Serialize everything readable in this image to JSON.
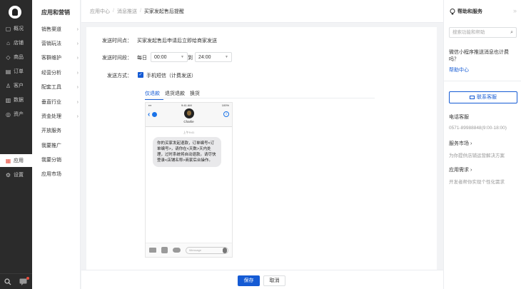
{
  "nav1": {
    "items": [
      {
        "icon": "overview-icon",
        "glyph": "▢",
        "label": "概况"
      },
      {
        "icon": "store-icon",
        "glyph": "⌂",
        "label": "店铺"
      },
      {
        "icon": "goods-icon",
        "glyph": "◇",
        "label": "商品"
      },
      {
        "icon": "order-icon",
        "glyph": "▤",
        "label": "订单"
      },
      {
        "icon": "customer-icon",
        "glyph": "♙",
        "label": "客户"
      },
      {
        "icon": "data-icon",
        "glyph": "▥",
        "label": "数据"
      },
      {
        "icon": "asset-icon",
        "glyph": "◎",
        "label": "资产"
      },
      {
        "icon": "app-icon",
        "glyph": "▦",
        "label": "应用"
      },
      {
        "icon": "settings-icon",
        "glyph": "⚙",
        "label": "设置"
      }
    ]
  },
  "nav2": {
    "title": "应用和营销",
    "items": [
      {
        "label": "销售渠道",
        "chevron": "›"
      },
      {
        "label": "营销玩法",
        "chevron": "›"
      },
      {
        "label": "客群维护",
        "chevron": "›"
      },
      {
        "label": "经营分析",
        "chevron": "›"
      },
      {
        "label": "配套工具",
        "chevron": "›"
      },
      {
        "label": "垂直行业",
        "chevron": "›"
      },
      {
        "label": "资金处理",
        "chevron": "›"
      },
      {
        "label": "开放服务",
        "chevron": ""
      },
      {
        "label": "我要推广",
        "chevron": ""
      },
      {
        "label": "我要分销",
        "chevron": ""
      },
      {
        "label": "应用市场",
        "chevron": ""
      }
    ]
  },
  "breadcrumb": {
    "a": "应用中心",
    "b": "消息推送",
    "c": "买家发起售后提醒",
    "sep": "/"
  },
  "form": {
    "time_point_label": "发送时间点：",
    "time_point_value": "买家发起售后申请后立即给商家发送",
    "time_range_label": "发送时间段：",
    "every_day": "每日",
    "start_time": "00:00",
    "to": "到",
    "end_time": "24:00",
    "method_label": "发送方式：",
    "sms_label": "手机短信（计费发送）"
  },
  "tabs": [
    "仅退款",
    "退货退款",
    "换货"
  ],
  "phone": {
    "time": "9:41 AM",
    "battery": "100%",
    "contact": "Charlie",
    "date": "上午9:41",
    "message": "你的买家发起退款，订单编号<订单编号>，请你在<天数>天内处理，过时系统将自动退款。请尽快登录<店铺名称>商家后台操作。",
    "input_placeholder": "iMessage"
  },
  "footer": {
    "save": "保存",
    "cancel": "取消"
  },
  "right": {
    "title": "帮助和服务",
    "collapse": "»",
    "search_placeholder": "搜索功能和帮助",
    "question": "微信小程序推送消息也计费吗？",
    "help_center": "帮助中心",
    "contact_btn": "联系客服",
    "phone_title": "电话客服",
    "phone_value": "0571-89988848(9:00-18:00)",
    "market_title": "服务市场 ›",
    "market_sub": "为你提供店铺运营解决方案",
    "demand_title": "应用需求 ›",
    "demand_sub": "开发者帮你实现个性化需求"
  },
  "colors": {
    "primary": "#155bd4",
    "sidebar_dark": "#2b2b2b"
  }
}
